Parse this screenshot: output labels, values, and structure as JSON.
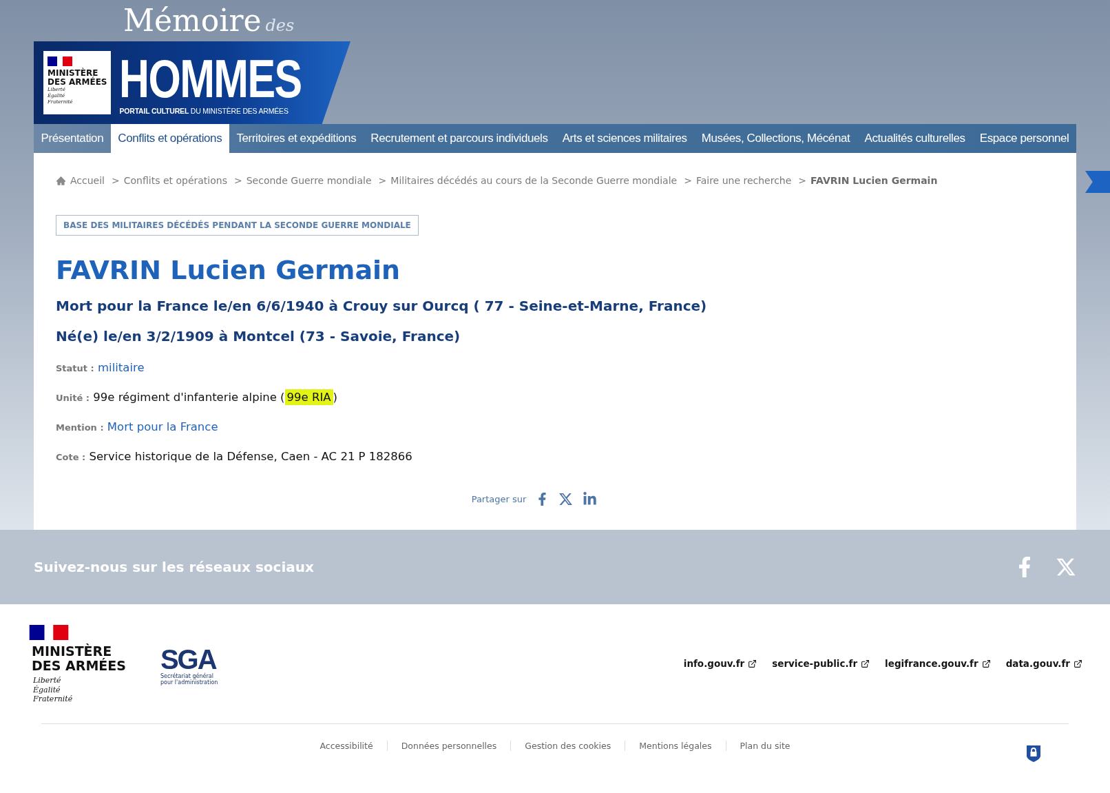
{
  "header": {
    "title_main": "Mémoire",
    "title_small": "des",
    "title_big": "HOMMES",
    "tagline_bold": "PORTAIL CULTUREL",
    "tagline": "DU MINISTÈRE DES ARMÉES",
    "logo": {
      "ministry": [
        "MINISTÈRE",
        "DES ARMÉES"
      ],
      "motto": [
        "Liberté",
        "Égalité",
        "Fraternité"
      ]
    }
  },
  "nav": [
    {
      "label": "Présentation",
      "selected": false
    },
    {
      "label": "Conflits et opérations",
      "selected": true
    },
    {
      "label": "Territoires et expéditions",
      "selected": false
    },
    {
      "label": "Recrutement et parcours individuels",
      "selected": false
    },
    {
      "label": "Arts et sciences militaires",
      "selected": false
    },
    {
      "label": "Musées, Collections, Mécénat",
      "selected": false
    },
    {
      "label": "Actualités culturelles",
      "selected": false
    },
    {
      "label": "Espace personnel",
      "selected": false
    }
  ],
  "breadcrumb": {
    "separator": ">",
    "items": [
      "Accueil",
      "Conflits et opérations",
      "Seconde Guerre mondiale",
      "Militaires décédés au cours de la Seconde Guerre mondiale",
      "Faire une recherche"
    ],
    "current": "FAVRIN Lucien Germain"
  },
  "record": {
    "database": "BASE DES MILITAIRES DÉCÉDÉS PENDANT LA SECONDE GUERRE MONDIALE",
    "name": "FAVRIN Lucien Germain",
    "death": "Mort pour la France le/en 6/6/1940 à Crouy sur Ourcq ( 77 - Seine-et-Marne, France)",
    "birth": "Né(e) le/en 3/2/1909 à Montcel (73 - Savoie, France)",
    "fields": [
      {
        "kind": "link",
        "label": "Statut :",
        "value": "militaire"
      },
      {
        "kind": "highlight",
        "label": "Unité :",
        "value": "99e régiment d'infanterie alpine (",
        "highlight": "99e RIA",
        "suffix": ")"
      },
      {
        "kind": "link",
        "label": "Mention :",
        "value": "Mort pour la France"
      },
      {
        "kind": "text",
        "label": "Cote :",
        "value": "Service historique de la Défense, Caen - AC 21 P 182866"
      }
    ]
  },
  "share": {
    "label": "Partager sur"
  },
  "social": {
    "title": "Suivez-nous sur les réseaux sociaux"
  },
  "footer": {
    "ministry": [
      "MINISTÈRE",
      "DES ARMÉES"
    ],
    "motto": [
      "Liberté",
      "Égalité",
      "Fraternité"
    ],
    "sga": {
      "acronym": "SGA",
      "caption": [
        "Secrétariat général",
        "pour l'administration"
      ]
    },
    "links": [
      "info.gouv.fr",
      "service-public.fr",
      "legifrance.gouv.fr",
      "data.gouv.fr"
    ],
    "bottom_links": [
      "Accessibilité",
      "Données personnelles",
      "Gestion des cookies",
      "Mentions légales",
      "Plan du site"
    ]
  }
}
